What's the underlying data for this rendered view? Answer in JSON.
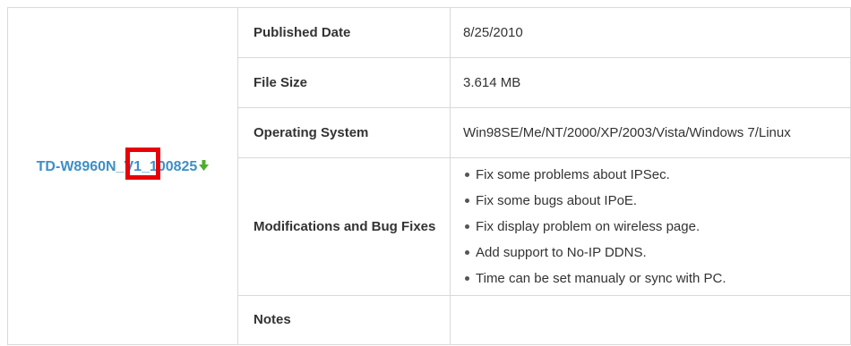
{
  "firmware": {
    "file_link": "TD-W8960N_V1_100825",
    "download_icon": "green-down-arrow-icon",
    "link_color": "#3d8fc6"
  },
  "details": {
    "published_date_label": "Published Date",
    "published_date_value": "8/25/2010",
    "file_size_label": "File Size",
    "file_size_value": "3.614 MB",
    "os_label": "Operating System",
    "os_value": "Win98SE/Me/NT/2000/XP/2003/Vista/Windows 7/Linux",
    "modifications_label": "Modifications and Bug Fixes",
    "modifications": [
      "Fix some problems about IPSec.",
      "Fix some bugs about IPoE.",
      "Fix display problem on wireless page.",
      "Add support to No-IP DDNS.",
      "Time can be set manualy or sync with PC."
    ],
    "notes_label": "Notes",
    "notes_value": ""
  },
  "annotation": {
    "highlight_color": "#e8000b"
  }
}
